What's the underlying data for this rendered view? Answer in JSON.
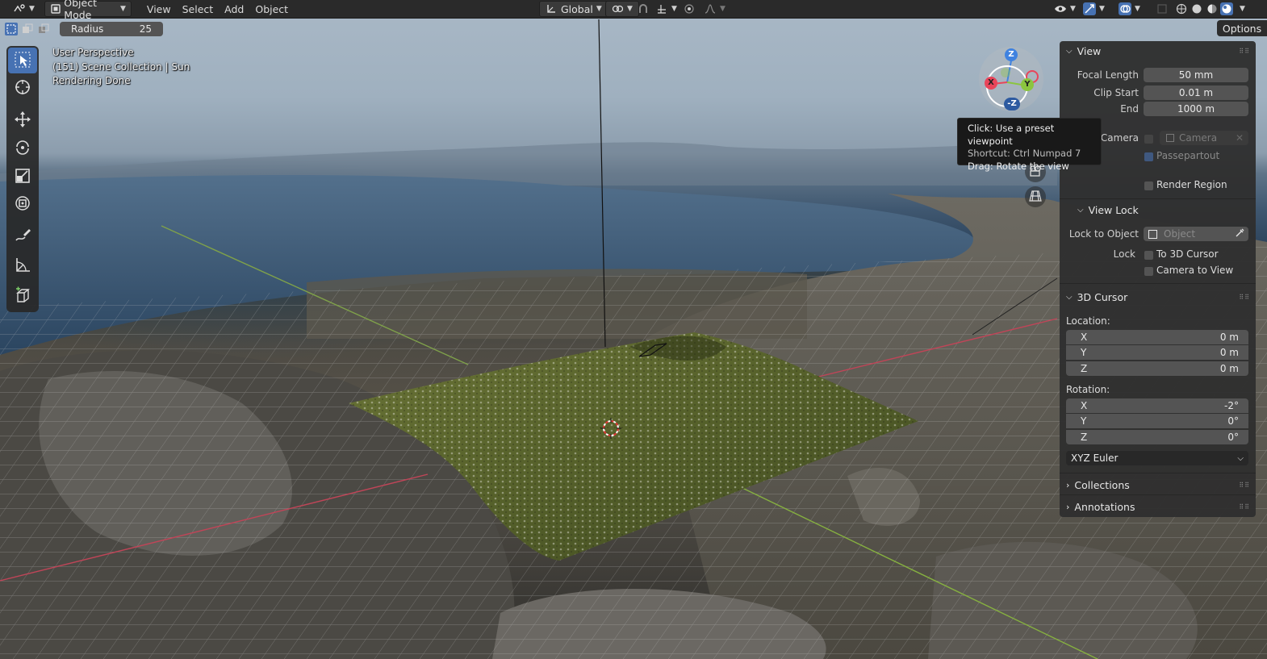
{
  "header": {
    "editor_type_icon": "3d-viewport-icon",
    "mode": "Object Mode",
    "menus": [
      "View",
      "Select",
      "Add",
      "Object"
    ],
    "orientation": "Global"
  },
  "tool_settings": {
    "radius_label": "Radius",
    "radius_value": "25",
    "options_label": "Options"
  },
  "viewport_info": {
    "line1": "User Perspective",
    "line2": "(151) Scene Collection | Sun",
    "line3": "Rendering Done"
  },
  "gizmo": {
    "z": "Z",
    "neg_z": "-Z",
    "x": "X",
    "y": "Y"
  },
  "tooltip": {
    "line1": "Click: Use a preset viewpoint",
    "line2": "Shortcut: Ctrl Numpad 7",
    "line3": "Drag: Rotate the view"
  },
  "npanel": {
    "view": {
      "title": "View",
      "focal_length_label": "Focal Length",
      "focal_length_value": "50 mm",
      "clip_start_label": "Clip Start",
      "clip_start_value": "0.01 m",
      "clip_end_label": "End",
      "clip_end_value": "1000 m",
      "camera_label": "Camera",
      "camera_value": "Camera",
      "passepartout_label": "Passepartout",
      "render_region_label": "Render Region"
    },
    "view_lock": {
      "title": "View Lock",
      "lock_to_object_label": "Lock to Object",
      "lock_to_object_placeholder": "Object",
      "lock_label": "Lock",
      "to_3d_cursor_label": "To 3D Cursor",
      "camera_to_view_label": "Camera to View"
    },
    "cursor": {
      "title": "3D Cursor",
      "location_label": "Location:",
      "loc_x_label": "X",
      "loc_x": "0 m",
      "loc_y_label": "Y",
      "loc_y": "0 m",
      "loc_z_label": "Z",
      "loc_z": "0 m",
      "rotation_label": "Rotation:",
      "rot_x_label": "X",
      "rot_x": "-2°",
      "rot_y_label": "Y",
      "rot_y": "0°",
      "rot_z_label": "Z",
      "rot_z": "0°",
      "rotation_mode": "XYZ Euler"
    },
    "collections": {
      "title": "Collections"
    },
    "annotations": {
      "title": "Annotations"
    }
  },
  "colors": {
    "accent": "#4772b3",
    "axis_x": "#e8455a",
    "axis_y": "#8bc53f",
    "axis_z": "#3f82e0"
  }
}
